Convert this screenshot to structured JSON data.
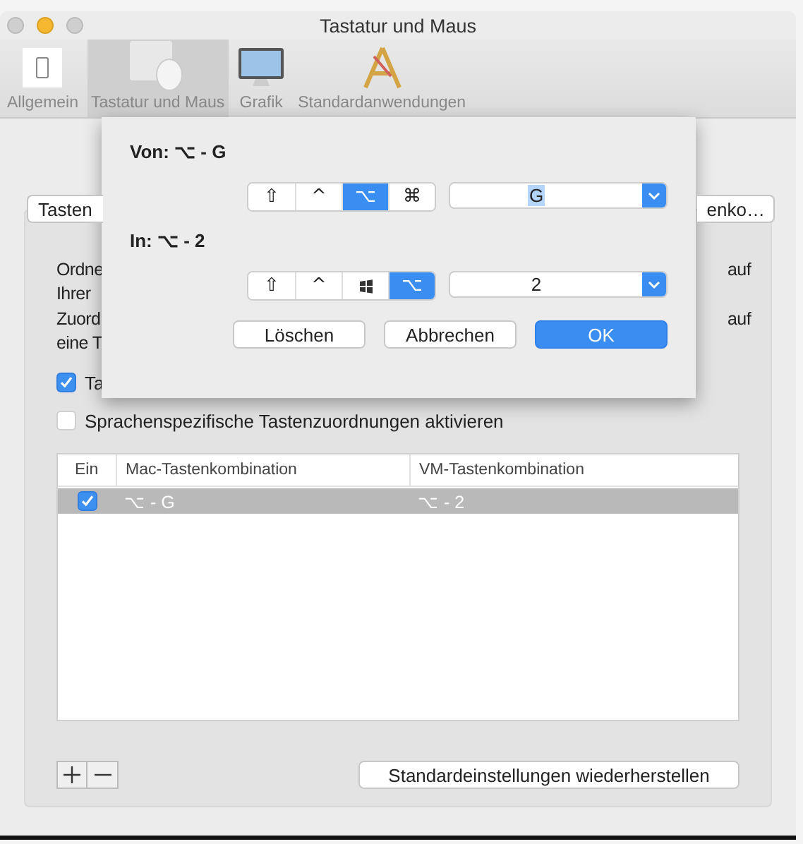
{
  "window": {
    "title": "Tastatur und Maus"
  },
  "toolbar": [
    {
      "label": "Allgemein",
      "kind": "general",
      "selected": false
    },
    {
      "label": "Tastatur und Maus",
      "kind": "keyboard",
      "selected": true
    },
    {
      "label": "Grafik",
      "kind": "display",
      "selected": false
    },
    {
      "label": "Standardanwendungen",
      "kind": "apps",
      "selected": false
    }
  ],
  "tab_buttons": [
    "Tasten",
    "enko…"
  ],
  "description": [
    {
      "left": "Ordne",
      "right": "auf"
    },
    {
      "left": "Ihrer"
    },
    {
      "left": "Zuord",
      "right": "auf"
    },
    {
      "left": "eine T"
    }
  ],
  "options": [
    {
      "label": "Ta",
      "checked": true
    },
    {
      "label": "Sprachenspezifische Tastenzuordnungen aktivieren",
      "checked": false
    }
  ],
  "table": {
    "columns": [
      "Ein",
      "Mac-Tastenkombination",
      "VM-Tastenkombination"
    ],
    "rows": [
      {
        "enabled": true,
        "selected": true,
        "mac": "⌥ - G",
        "vm": "⌥ - 2"
      }
    ]
  },
  "restore_button": "Standardeinstellungen wiederherstellen",
  "sheet": {
    "sections": [
      {
        "heading": "Von:  ⌥ - G",
        "modifiers": [
          {
            "kind": "glyph",
            "glyph": "⇧",
            "selected": false
          },
          {
            "kind": "glyph",
            "glyph": "^",
            "selected": false
          },
          {
            "kind": "glyph",
            "glyph": "⌥",
            "selected": true
          },
          {
            "kind": "glyph",
            "glyph": "⌘",
            "selected": false
          }
        ],
        "key": "G",
        "key_highlighted": true
      },
      {
        "heading": "In:  ⌥ - 2",
        "modifiers": [
          {
            "kind": "glyph",
            "glyph": "⇧",
            "selected": false
          },
          {
            "kind": "glyph",
            "glyph": "^",
            "selected": false
          },
          {
            "kind": "windows",
            "selected": false
          },
          {
            "kind": "glyph",
            "glyph": "⌥",
            "selected": true
          }
        ],
        "key": "2",
        "key_highlighted": false
      }
    ],
    "buttons": [
      {
        "label": "Löschen",
        "default": false
      },
      {
        "label": "Abbrechen",
        "default": false
      },
      {
        "label": "OK",
        "default": true
      }
    ]
  }
}
